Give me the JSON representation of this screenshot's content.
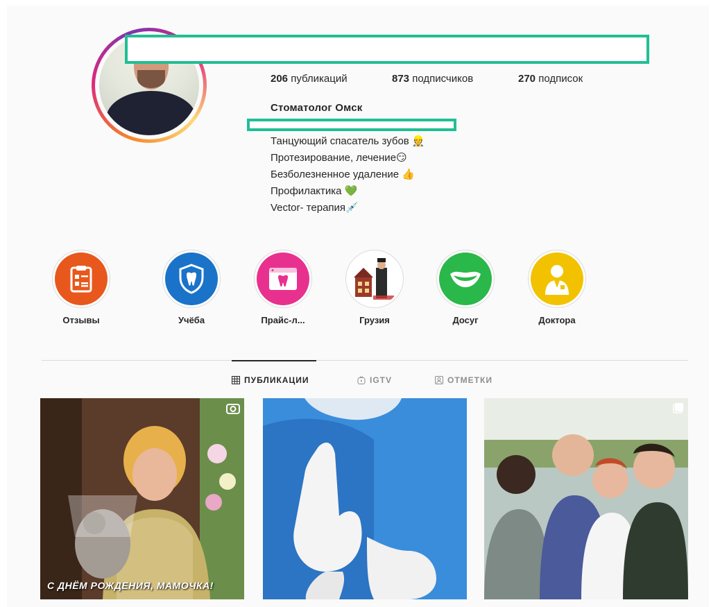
{
  "profile": {
    "stats": {
      "posts_count": "206",
      "posts_label": "публикаций",
      "followers_count": "873",
      "followers_label": "подписчиков",
      "following_count": "270",
      "following_label": "подписок"
    },
    "full_name": "Стоматолог Омск",
    "bio": [
      "Танцующий спасатель зубов 👷",
      "Протезирование, лечение😏",
      "Безболезненное удаление 👍",
      "Профилактика 💚",
      "Vector- терапия💉"
    ]
  },
  "highlights": [
    {
      "label": "Отзывы",
      "icon": "clipboard-icon",
      "color": "#e8581c"
    },
    {
      "label": "Учёба",
      "icon": "tooth-shield-icon",
      "color": "#1a73c9"
    },
    {
      "label": "Прайс-л...",
      "icon": "tooth-browser-icon",
      "color": "#e8318f"
    },
    {
      "label": "Грузия",
      "icon": "georgia-illustration",
      "color": "#ffffff"
    },
    {
      "label": "Досуг",
      "icon": "smile-icon",
      "color": "#2bb84a"
    },
    {
      "label": "Доктора",
      "icon": "doctor-icon",
      "color": "#f2c200"
    }
  ],
  "tabs": [
    {
      "label": "ПУБЛИКАЦИИ",
      "icon": "grid-icon",
      "active": true
    },
    {
      "label": "IGTV",
      "icon": "igtv-icon",
      "active": false
    },
    {
      "label": "ОТМЕТКИ",
      "icon": "tagged-icon",
      "active": false
    }
  ],
  "posts": [
    {
      "caption": "С ДНЁМ РОЖДЕНИЯ, МАМОЧКА!",
      "type_icon": "video-icon"
    },
    {
      "caption": "",
      "type_icon": ""
    },
    {
      "caption": "",
      "type_icon": "carousel-icon"
    }
  ],
  "colors": {
    "accent_redaction": "#1fbf93",
    "text": "#262626",
    "muted": "#8e8e8e"
  }
}
